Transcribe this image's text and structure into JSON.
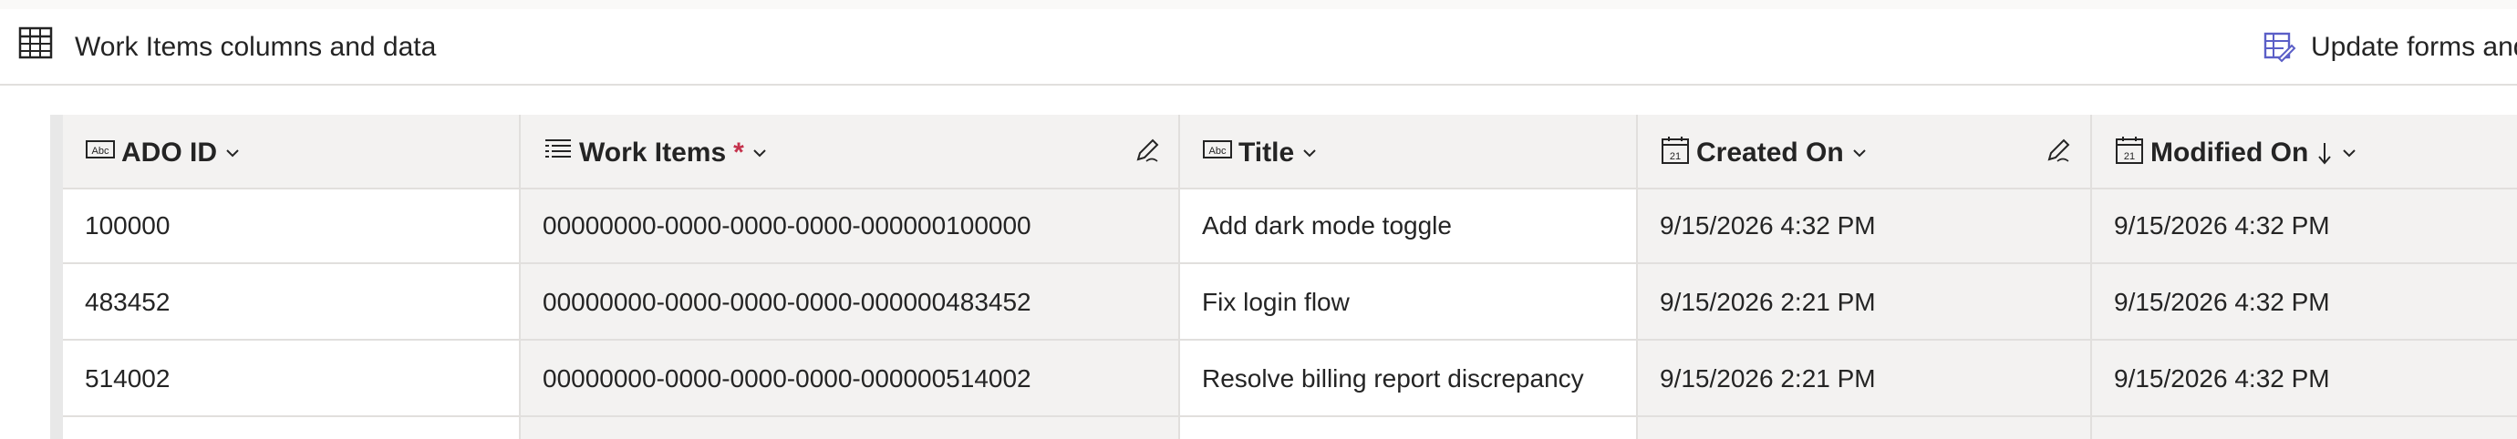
{
  "header": {
    "title": "Work Items columns and data",
    "update_label": "Update forms and"
  },
  "columns": [
    {
      "label": "ADO ID",
      "icon": "text-field-icon",
      "required": false,
      "sort": ""
    },
    {
      "label": "Work Items",
      "icon": "list-icon",
      "required": true,
      "sort": ""
    },
    {
      "label": "Title",
      "icon": "text-field-icon",
      "required": false,
      "sort": ""
    },
    {
      "label": "Created On",
      "icon": "calendar-icon",
      "required": false,
      "sort": ""
    },
    {
      "label": "Modified On",
      "icon": "calendar-icon",
      "required": false,
      "sort": "descending"
    }
  ],
  "rows": [
    {
      "ado_id": "100000",
      "work_items": "00000000-0000-0000-0000-000000100000",
      "title": "Add dark mode toggle",
      "created_on": "9/15/2026 4:32 PM",
      "modified_on": "9/15/2026 4:32 PM"
    },
    {
      "ado_id": "483452",
      "work_items": "00000000-0000-0000-0000-000000483452",
      "title": "Fix login flow",
      "created_on": "9/15/2026 2:21 PM",
      "modified_on": "9/15/2026 4:32 PM"
    },
    {
      "ado_id": "514002",
      "work_items": "00000000-0000-0000-0000-000000514002",
      "title": "Resolve billing report discrepancy",
      "created_on": "9/15/2026 2:21 PM",
      "modified_on": "9/15/2026 4:32 PM"
    }
  ],
  "colors": {
    "required_marker": "#c4314b",
    "header_bg": "#f3f2f1",
    "border": "#e1dfdd",
    "text": "#242424"
  }
}
